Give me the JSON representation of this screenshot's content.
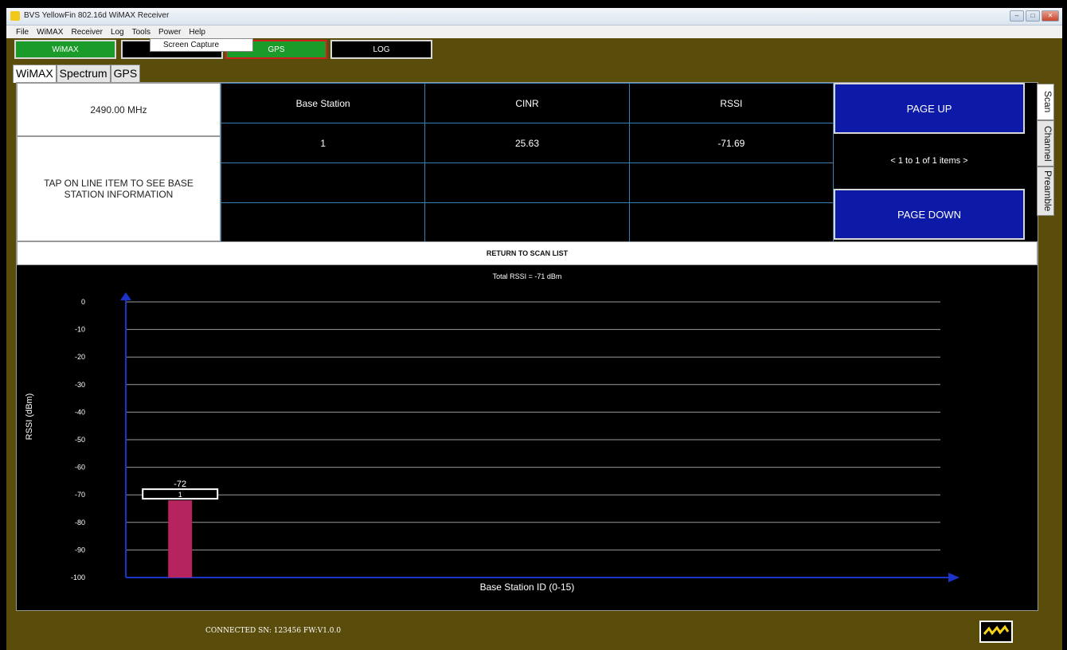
{
  "window": {
    "title": "BVS YellowFin 802.16d WiMAX Receiver",
    "controls": [
      "minimize-icon",
      "maximize-icon",
      "close-icon"
    ]
  },
  "menu": {
    "items": [
      "File",
      "WiMAX",
      "Receiver",
      "Log",
      "Tools",
      "Power",
      "Help"
    ],
    "open_dropdown_item": "Screen Capture"
  },
  "status_buttons": [
    {
      "label": "WiMAX",
      "color": "#1a9b2a"
    },
    {
      "label": "",
      "color": "#000000"
    },
    {
      "label": "GPS",
      "color": "#1a9b2a"
    },
    {
      "label": "LOG",
      "color": "#000000"
    }
  ],
  "tabs": [
    "WiMAX",
    "Spectrum",
    "GPS"
  ],
  "side_tabs": [
    "Scan",
    "Channel",
    "Preamble"
  ],
  "frequency": "2490.00 MHz",
  "instruction": "TAP ON LINE ITEM TO SEE BASE STATION INFORMATION",
  "table": {
    "headers": [
      "Base Station",
      "CINR",
      "RSSI"
    ],
    "rows": [
      [
        "1",
        "25.63",
        "-71.69"
      ],
      [
        "",
        "",
        ""
      ],
      [
        "",
        "",
        ""
      ]
    ]
  },
  "paging": {
    "page_up": "PAGE UP",
    "page_down": "PAGE DOWN",
    "info": "< 1 to 1 of 1 items >"
  },
  "return_label": "RETURN TO SCAN LIST",
  "chart_data": {
    "type": "bar",
    "title": "Total RSSI = -71 dBm",
    "xlabel": "Base Station ID (0-15)",
    "ylabel": "RSSI (dBm)",
    "ylim": [
      -100,
      0
    ],
    "xlim": [
      0,
      15
    ],
    "yticks": [
      0,
      -10,
      -20,
      -30,
      -40,
      -50,
      -60,
      -70,
      -80,
      -90,
      -100
    ],
    "grid": true,
    "series": [
      {
        "values": [
          {
            "x": 1,
            "y": -72,
            "label": "-72",
            "id_label": "1"
          }
        ],
        "color": "#b5245e"
      }
    ]
  },
  "footer": {
    "status": "CONNECTED SN: 123456   FW:V1.0.0",
    "icon": "lightning-icon"
  }
}
